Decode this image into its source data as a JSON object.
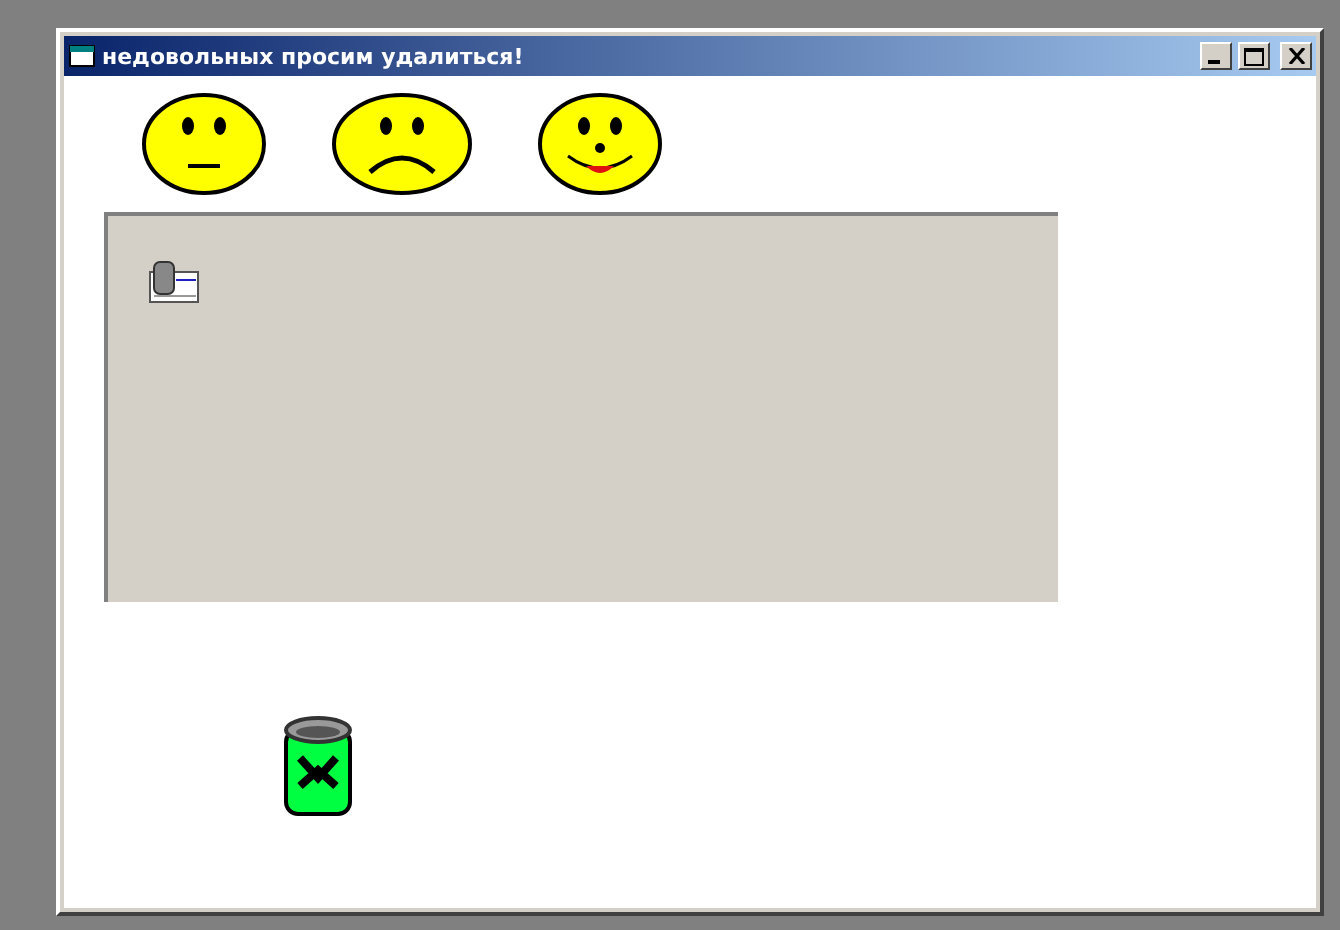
{
  "window": {
    "title": "недовольных просим удалиться!"
  },
  "faces": [
    {
      "kind": "neutral"
    },
    {
      "kind": "sad"
    },
    {
      "kind": "happy"
    }
  ]
}
